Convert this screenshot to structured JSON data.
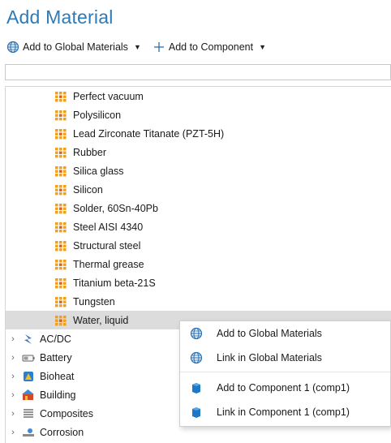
{
  "title": "Add Material",
  "toolbar": {
    "global_label": "Add to Global Materials",
    "component_label": "Add to Component"
  },
  "search": {
    "value": "",
    "placeholder": ""
  },
  "materials": [
    "Perfect vacuum",
    "Polysilicon",
    "Lead Zirconate Titanate (PZT-5H)",
    "Rubber",
    "Silica glass",
    "Silicon",
    "Solder, 60Sn-40Pb",
    "Steel AISI 4340",
    "Structural steel",
    "Thermal grease",
    "Titanium beta-21S",
    "Tungsten",
    "Water, liquid"
  ],
  "selected_material": "Water, liquid",
  "groups": [
    {
      "label": "AC/DC",
      "icon": "acdc-icon"
    },
    {
      "label": "Battery",
      "icon": "battery-icon"
    },
    {
      "label": "Bioheat",
      "icon": "bioheat-icon"
    },
    {
      "label": "Building",
      "icon": "building-icon"
    },
    {
      "label": "Composites",
      "icon": "composites-icon"
    },
    {
      "label": "Corrosion",
      "icon": "corrosion-icon"
    }
  ],
  "context_menu": [
    {
      "label": "Add to Global Materials",
      "icon": "globe-icon"
    },
    {
      "label": "Link in Global Materials",
      "icon": "globe-icon"
    },
    {
      "label": "Add to Component 1 (comp1)",
      "icon": "component-icon"
    },
    {
      "label": "Link in Component 1 (comp1)",
      "icon": "component-icon"
    }
  ],
  "colors": {
    "title": "#2e7ab8",
    "material_icon_orange": "#f0a020",
    "selection_bg": "#dcdcdc",
    "component_blue": "#1e78c8"
  }
}
